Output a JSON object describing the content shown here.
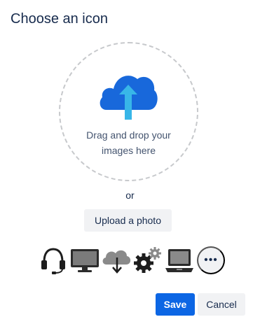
{
  "dialog": {
    "title": "Choose an icon"
  },
  "dropzone": {
    "line1": "Drag and drop your",
    "line2": "images here",
    "icon": "cloud-upload-icon",
    "colors": {
      "cloud": "#1868db",
      "arrow": "#38b6e8"
    }
  },
  "or_text": "or",
  "upload_label": "Upload a photo",
  "icon_options": [
    {
      "name": "headset-icon"
    },
    {
      "name": "monitor-icon"
    },
    {
      "name": "cloud-download-icon"
    },
    {
      "name": "gears-icon"
    },
    {
      "name": "laptop-icon"
    }
  ],
  "more_label": "•••",
  "footer": {
    "save_label": "Save",
    "cancel_label": "Cancel"
  },
  "colors": {
    "primary": "#0c66e4",
    "neutral_button": "#f1f2f4",
    "text": "#172b4d"
  }
}
